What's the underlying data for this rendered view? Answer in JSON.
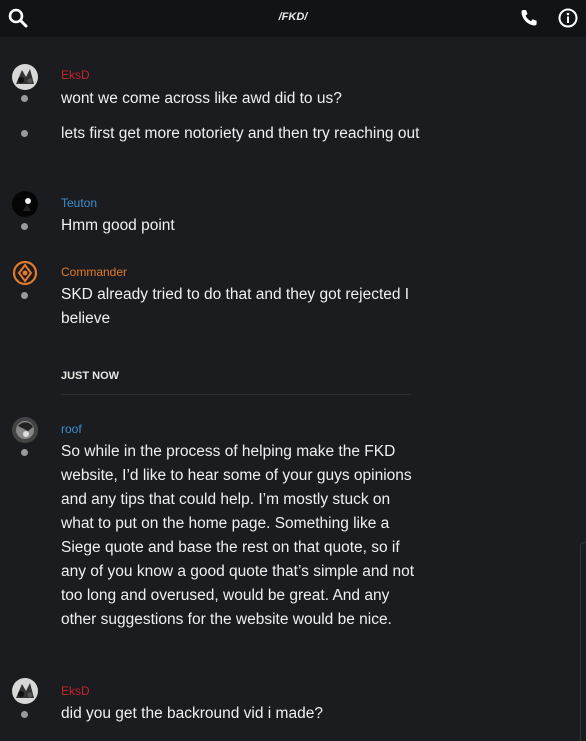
{
  "header": {
    "title": "/FKD/",
    "icons": [
      "search-icon",
      "phone-icon",
      "info-icon"
    ]
  },
  "messages": [
    {
      "user": "EksD",
      "user_color": "#c0282d",
      "lines": [
        "wont we come across like awd did to us?",
        "lets first get more notoriety and then try reaching out"
      ]
    },
    {
      "user": "Teuton",
      "user_color": "#3c8fcf",
      "lines": [
        "Hmm good point"
      ]
    },
    {
      "user": "Commander",
      "user_color": "#e07a2e",
      "lines": [
        "SKD already tried to do that and they got rejected I believe"
      ]
    },
    {
      "user": "roof",
      "user_color": "#3c8fcf",
      "lines": [
        "So while in the process of helping make the FKD website, I’d like to hear some of your guys opinions and any tips that could help. I’m mostly stuck on what to put on the home page. Something like a Siege quote and base the rest on that quote, so if any of you know a good quote that’s simple and not too long and overused, would be great. And any other suggestions for the website would be nice."
      ]
    },
    {
      "user": "EksD",
      "user_color": "#c0282d",
      "lines": [
        "did you get the backround vid i made?"
      ]
    }
  ],
  "divider_label": "JUST NOW"
}
